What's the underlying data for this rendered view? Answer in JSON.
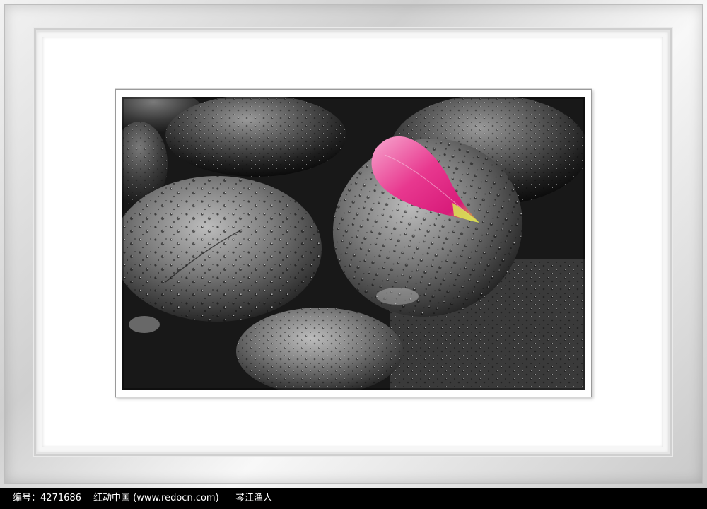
{
  "image": {
    "subject": "wet black stones with a pink petal",
    "accent_colors": {
      "petal": "#e8388f",
      "stone": "#2b2b2b",
      "frame": "#d0d0d0"
    }
  },
  "watermark": {
    "id_text": "编号：4271686",
    "site_text": "红动中国 (www.redocn.com)",
    "author_text": "琴江渔人"
  }
}
